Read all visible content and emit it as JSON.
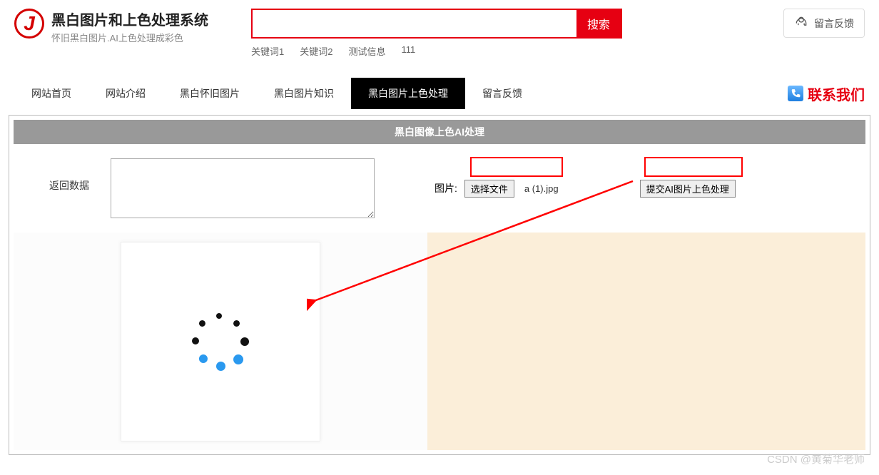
{
  "header": {
    "title": "黑白图片和上色处理系统",
    "subtitle": "怀旧黑白图片.AI上色处理成彩色"
  },
  "search": {
    "placeholder": "",
    "button": "搜索",
    "keywords": [
      "关键词1",
      "关键词2",
      "测试信息",
      "111"
    ]
  },
  "feedback_top": "留言反馈",
  "nav": {
    "items": [
      {
        "label": "网站首页",
        "active": false
      },
      {
        "label": "网站介绍",
        "active": false
      },
      {
        "label": "黑白怀旧图片",
        "active": false
      },
      {
        "label": "黑白图片知识",
        "active": false
      },
      {
        "label": "黑白图片上色处理",
        "active": true
      },
      {
        "label": "留言反馈",
        "active": false
      }
    ]
  },
  "contact": "联系我们",
  "panel": {
    "title": "黑白图像上色AI处理",
    "return_label": "返回数据",
    "image_label": "图片:",
    "file_button": "选择文件",
    "file_name": "a (1).jpg",
    "submit_button": "提交AI图片上色处理"
  },
  "watermark": "CSDN @黄菊华老师"
}
